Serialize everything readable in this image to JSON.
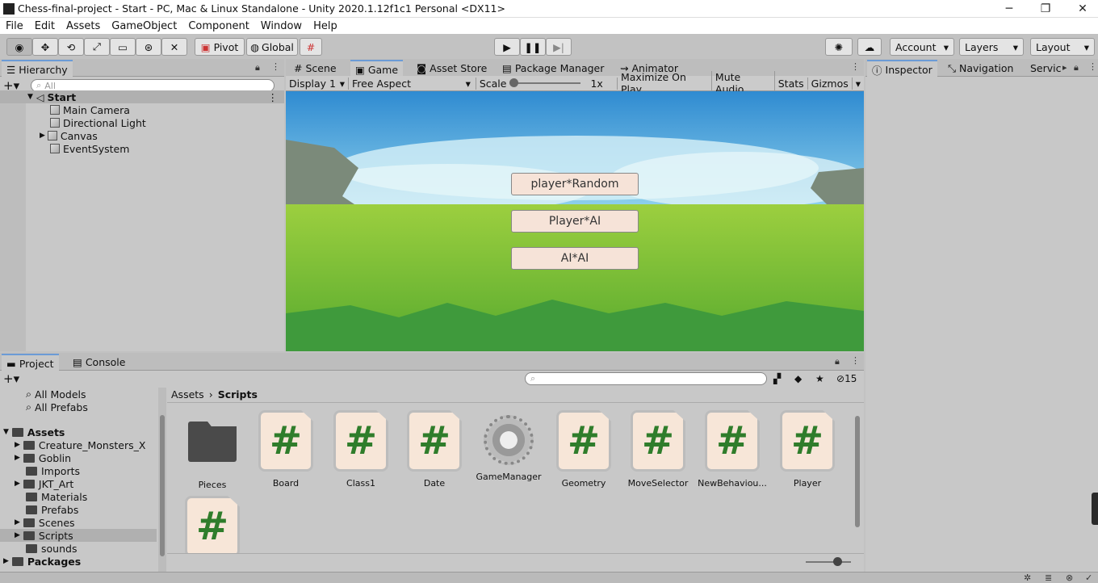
{
  "window": {
    "title": "Chess-final-project - Start - PC, Mac & Linux Standalone - Unity 2020.1.12f1c1 Personal <DX11>",
    "minimize": "─",
    "restore": "❐",
    "close": "✕"
  },
  "menu": [
    "File",
    "Edit",
    "Assets",
    "GameObject",
    "Component",
    "Window",
    "Help"
  ],
  "toolbar": {
    "pivot": "Pivot",
    "global": "Global",
    "account": "Account",
    "layers": "Layers",
    "layout": "Layout"
  },
  "hierarchy": {
    "tab": "Hierarchy",
    "search_placeholder": "All",
    "scene": "Start",
    "items": [
      "Main Camera",
      "Directional Light",
      "Canvas",
      "EventSystem"
    ]
  },
  "center_tabs": [
    "Scene",
    "Game",
    "Asset Store",
    "Package Manager",
    "Animator"
  ],
  "game_bar": {
    "display": "Display 1",
    "aspect": "Free Aspect",
    "scale_label": "Scale",
    "scale_value": "1x",
    "maximize": "Maximize On Play",
    "mute": "Mute Audio",
    "stats": "Stats",
    "gizmos": "Gizmos"
  },
  "game_buttons": [
    "player*Random",
    "Player*AI",
    "AI*AI"
  ],
  "inspector_tabs": [
    "Inspector",
    "Navigation",
    "Servic"
  ],
  "project": {
    "tab": "Project",
    "console_tab": "Console",
    "hidden_count": "15",
    "breadcrumb_root": "Assets",
    "breadcrumb_leaf": "Scripts",
    "favorites": [
      "All Models",
      "All Prefabs"
    ],
    "tree_root": "Assets",
    "tree": [
      "Creature_Monsters_X",
      "Goblin",
      "Imports",
      "JKT_Art",
      "Materials",
      "Prefabs",
      "Scenes",
      "Scripts",
      "sounds"
    ],
    "packages": "Packages",
    "assets": [
      "Pieces",
      "Board",
      "Class1",
      "Date",
      "GameManager",
      "Geometry",
      "MoveSelector",
      "NewBehaviou...",
      "Player"
    ]
  },
  "colors": {
    "accent": "#6b9bd6",
    "script_hash": "#2f7d2b"
  }
}
